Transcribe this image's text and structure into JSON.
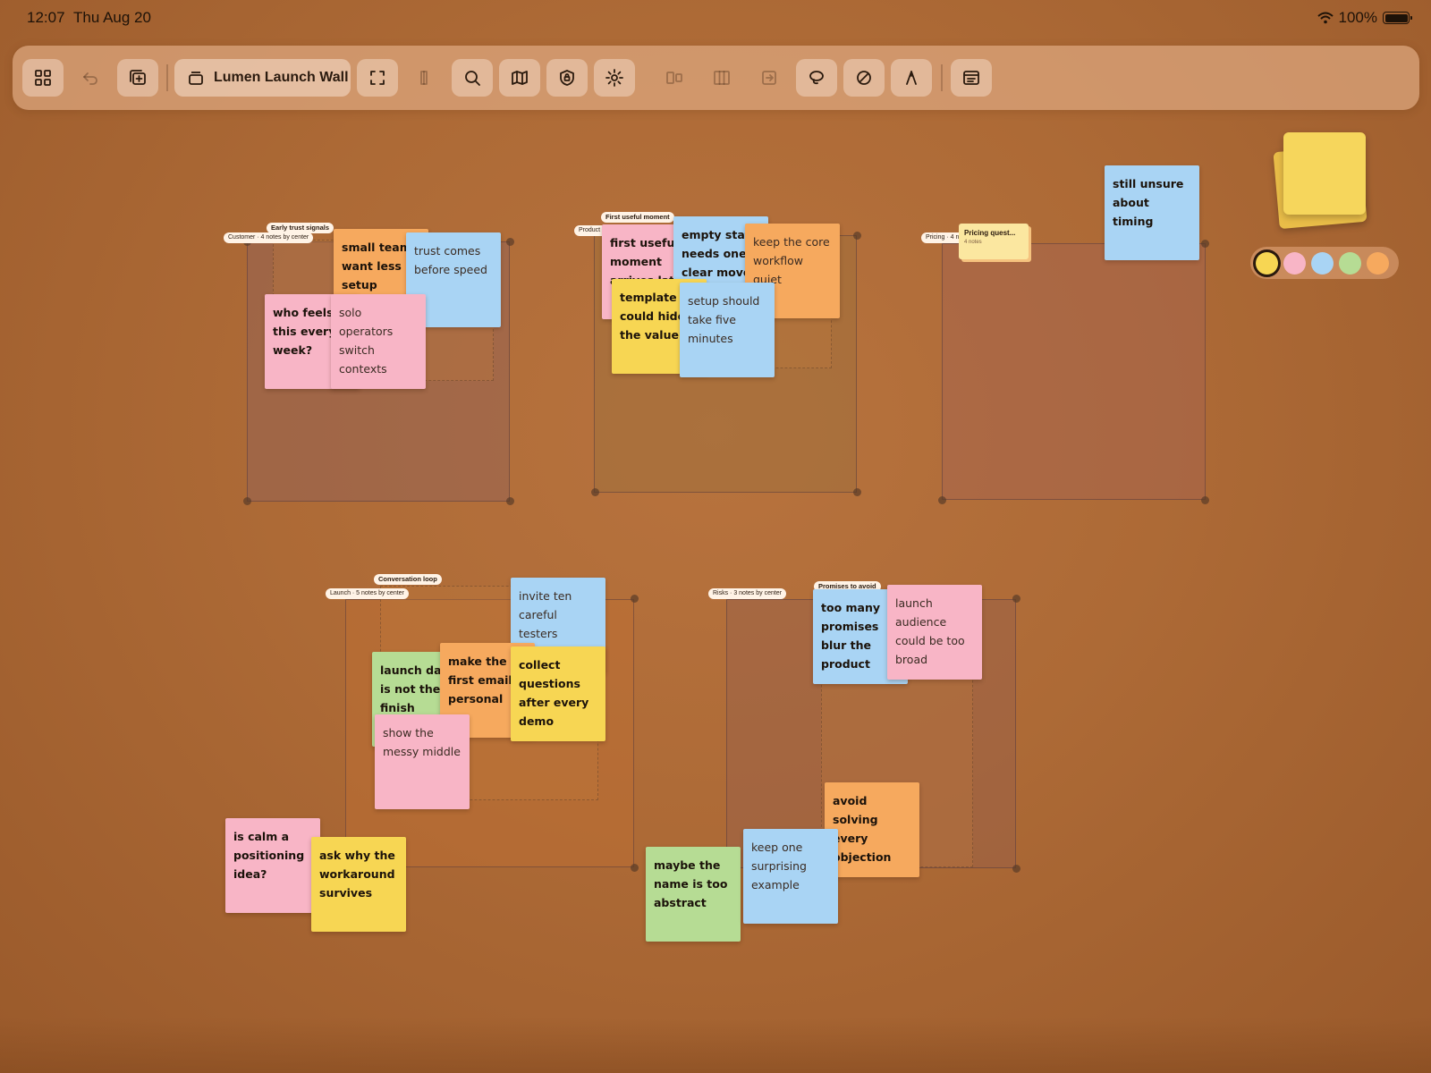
{
  "status_bar": {
    "time": "12:07",
    "date": "Thu Aug 20",
    "battery": "100%"
  },
  "toolbar": {
    "board_title": "Lumen Launch Wall",
    "icons": [
      "grid-icon",
      "undo-icon",
      "add-board-icon",
      "stack-icon",
      "fullscreen-icon",
      "bookmark-icon",
      "search-icon",
      "map-icon",
      "shield-icon",
      "gear-icon",
      "align-icon",
      "columns-icon",
      "export-icon",
      "lasso-icon",
      "pen-icon",
      "pencil-icon",
      "sidebar-icon"
    ]
  },
  "palette": {
    "colors": [
      "#f7d653",
      "#f8b5c6",
      "#a9d4f4",
      "#b6dc94",
      "#f6a95e"
    ],
    "selected": "yellow"
  },
  "groups": [
    {
      "label": "Customer · 4 notes by center",
      "title": "Early trust signals"
    },
    {
      "label": "Product · 5",
      "title": "First useful moment"
    },
    {
      "label": "Pricing · 4 notes",
      "stack_title": "Pricing quest...",
      "stack_count": "4 notes"
    },
    {
      "label": "Launch · 5 notes by center",
      "title": "Conversation loop"
    },
    {
      "label": "Risks · 3 notes by center",
      "title": "Promises to avoid"
    }
  ],
  "notes": {
    "small_teams": "small teams want less setup",
    "trust_comes": "trust comes before speed",
    "who_feels": "who feels this every week?",
    "solo_operators": "solo operators switch contexts",
    "first_useful": "first useful moment arrives late",
    "empty_state": "empty state needs one clear move",
    "keep_core": "keep the core workflow quiet",
    "template_could": "template could hide the value",
    "setup_should": "setup should take five minutes",
    "still_unsure": "still unsure about timing",
    "invite_ten": "invite ten careful testers",
    "launch_day": "launch day is not the finish",
    "make_first": "make the first email personal",
    "collect_questions": "collect questions after every demo",
    "show_messy": "show the messy middle",
    "is_calm": "is calm a positioning idea?",
    "ask_why": "ask why the workaround survives",
    "too_many": "too many promises blur the product",
    "launch_audience": "launch audience could be too broad",
    "avoid_solving": "avoid solving every objection",
    "maybe_name": "maybe the name is too abstract",
    "keep_one": "keep one surprising example"
  }
}
